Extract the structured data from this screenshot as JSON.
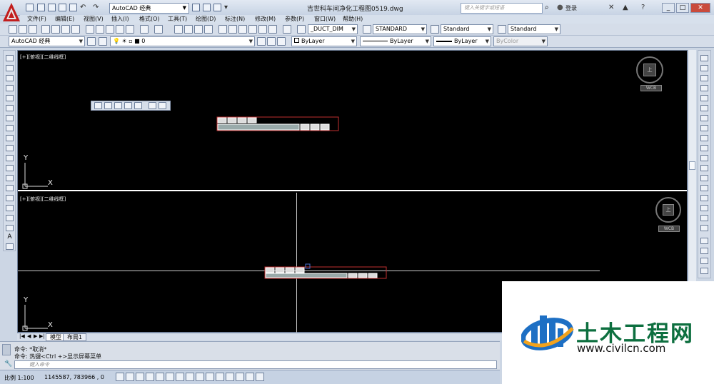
{
  "titlebar": {
    "workspace": "AutoCAD 经典",
    "doc_title": "吉世科车间净化工程图0519.dwg",
    "search_placeholder": "键入关键字或短语",
    "login": "登录"
  },
  "menu": [
    "文件(F)",
    "编辑(E)",
    "视图(V)",
    "插入(I)",
    "格式(O)",
    "工具(T)",
    "绘图(D)",
    "标注(N)",
    "修改(M)",
    "参数(P)",
    "窗口(W)",
    "帮助(H)"
  ],
  "toolbar1": {
    "dim_style": "_DUCT_DIM",
    "text_style": "STANDARD",
    "table_style": "Standard",
    "mleader_style": "Standard"
  },
  "toolbar2": {
    "workspace2": "AutoCAD 经典",
    "layer": "0",
    "color": "ByLayer",
    "linetype": "ByLayer",
    "lineweight": "ByLayer",
    "plotstyle": "ByColor"
  },
  "viewports": {
    "top_label": "[+][俯视][二维线框]",
    "bottom_label": "[+][俯视][二维线框]",
    "wcs": "WCB",
    "compass": "上",
    "y_axis": "Y",
    "x_axis": "X"
  },
  "tabs": [
    "模型",
    "布局1"
  ],
  "command": {
    "line1": "命令:  *取消*",
    "line2": "命令:  热键<Ctrl +>显示屏幕菜单",
    "input_placeholder": "键入命令"
  },
  "status": {
    "scale": "比例 1:100",
    "coords": "1145587,  783966 ,  0"
  },
  "watermark": {
    "text": "土木工程网",
    "url": "www.civilcn.com"
  },
  "colors": {
    "accent": "#0d6f3f",
    "canvas": "#000000",
    "chrome": "#d5dde9"
  }
}
